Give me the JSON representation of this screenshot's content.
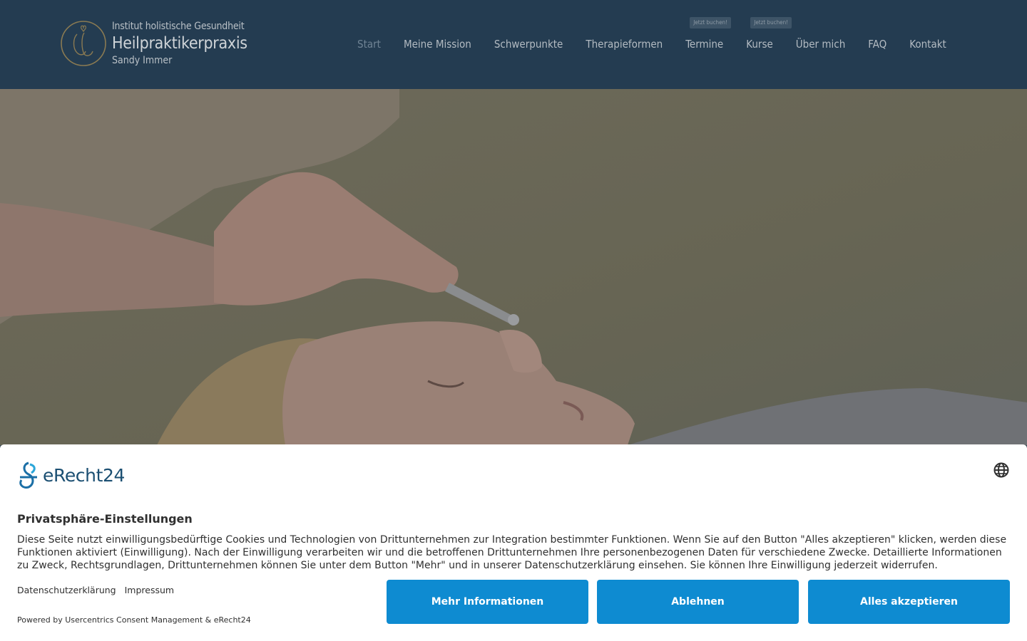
{
  "header": {
    "logo": {
      "line1": "Institut holistische Gesundheit",
      "line2": "Heilpraktikerpraxis",
      "line3": "Sandy Immer"
    },
    "nav": [
      {
        "label": "Start",
        "active": true
      },
      {
        "label": "Meine Mission"
      },
      {
        "label": "Schwerpunkte"
      },
      {
        "label": "Therapieformen"
      },
      {
        "label": "Termine",
        "badge": "Jetzt buchen!"
      },
      {
        "label": "Kurse",
        "badge": "Jetzt buchen!"
      },
      {
        "label": "Über mich"
      },
      {
        "label": "FAQ"
      },
      {
        "label": "Kontakt"
      }
    ]
  },
  "consent": {
    "brand": "eRecht24",
    "title": "Privatsphäre-Einstellungen",
    "text": "Diese Seite nutzt einwilligungsbedürftige Cookies und Technologien von Drittunternehmen zur Integration bestimmter Funktionen. Wenn Sie auf den Button \"Alles akzeptieren\" klicken, werden diese Funktionen aktiviert (Einwilligung). Nach der Einwilligung verarbeiten wir und die betroffenen Drittunternehmen Ihre personenbezogenen Daten für verschiedene Zwecke. Detaillierte Informationen zu Zweck, Rechtsgrundlagen, Drittunternehmen können Sie unter dem Button \"Mehr\" und in unserer Datenschutzerklärung einsehen. Sie können Ihre Einwilligung jederzeit widerrufen.",
    "links": [
      "Datenschutzerklärung",
      "Impressum"
    ],
    "powered": "Powered by Usercentrics Consent Management & eRecht24",
    "buttons": {
      "more": "Mehr Informationen",
      "deny": "Ablehnen",
      "accept": "Alles akzeptieren"
    }
  },
  "colors": {
    "header_bg": "#243c51",
    "button_bg": "#0e8bd1",
    "brand_blue": "#1b4f72"
  }
}
